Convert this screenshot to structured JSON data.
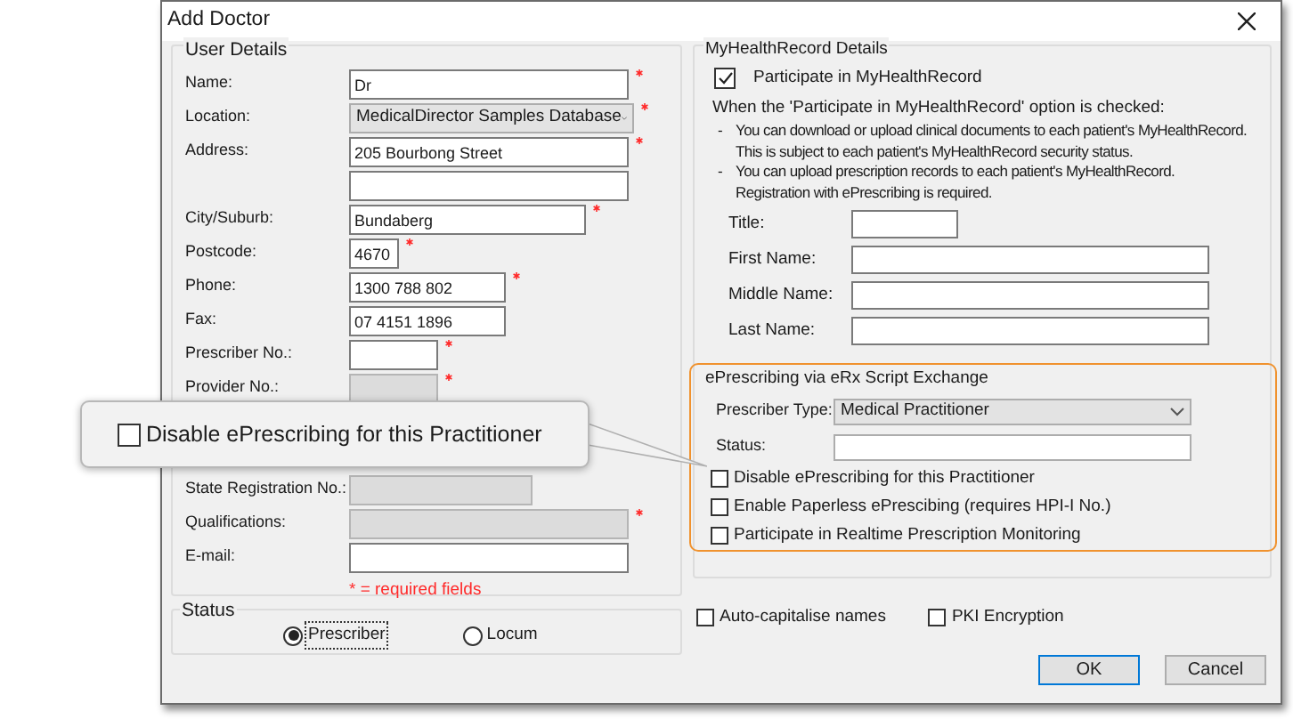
{
  "window": {
    "title": "Add Doctor"
  },
  "user_details": {
    "title": "User Details",
    "fields": [
      {
        "label": "Name:",
        "kind": "text",
        "value": "Dr",
        "required": true,
        "disabled": false
      },
      {
        "label": "Location:",
        "kind": "dropdown",
        "value": "MedicalDirector Samples Database",
        "required": true
      },
      {
        "label": "Address:",
        "kind": "text",
        "value": "205 Bourbong Street",
        "required": true,
        "disabled": false
      },
      {
        "kind": "text",
        "required": false,
        "disabled": false
      },
      {
        "label": "City/Suburb:",
        "kind": "text",
        "value": "Bundaberg",
        "required": true,
        "disabled": false
      },
      {
        "label": "Postcode:",
        "kind": "text",
        "value": "4670",
        "required": true,
        "disabled": false
      },
      {
        "label": "Phone:",
        "kind": "text",
        "value": "1300 788 802",
        "required": true,
        "disabled": false
      },
      {
        "label": "Fax:",
        "kind": "text",
        "value": "07 4151 1896",
        "required": false,
        "disabled": false
      },
      {
        "label": "Prescriber No.:",
        "kind": "text",
        "required": true,
        "disabled": false
      },
      {
        "label": "Provider No.:",
        "kind": "text",
        "required": true,
        "disabled": true
      }
    ],
    "fields_below_callout": [
      {
        "label": "State Registration No.:",
        "required": false,
        "disabled": true
      },
      {
        "label": "Qualifications:",
        "required": true,
        "disabled": true
      },
      {
        "label": "E-mail:",
        "required": false,
        "disabled": false
      }
    ],
    "required_note": "* = required fields"
  },
  "status": {
    "title": "Status",
    "options": [
      {
        "label": "Prescriber",
        "selected": true
      },
      {
        "label": "Locum",
        "selected": false
      }
    ]
  },
  "myhealthrecord": {
    "title": "MyHealthRecord Details",
    "participate": {
      "label": "Participate in MyHealthRecord",
      "checked": true
    },
    "intro": "When the 'Participate in MyHealthRecord' option is checked:",
    "bullets": [
      {
        "marker": "-",
        "lines": [
          "You can download or upload clinical documents to each patient's MyHealthRecord.",
          "This is subject to each patient's MyHealthRecord security status."
        ]
      },
      {
        "marker": "-",
        "lines": [
          "You can upload prescription records to each patient's MyHealthRecord.",
          "Registration with ePrescribing is required."
        ]
      }
    ],
    "fields": [
      {
        "label": "Title:",
        "kind": "short"
      },
      {
        "label": "First Name:",
        "kind": "long"
      },
      {
        "label": "Middle Name:",
        "kind": "long"
      },
      {
        "label": "Last Name:",
        "kind": "long"
      }
    ]
  },
  "eprescribing": {
    "title": "ePrescribing via eRx Script Exchange",
    "highlighted": true,
    "prescriber_type": {
      "label": "Prescriber Type:",
      "value": "Medical Practitioner"
    },
    "status": {
      "label": "Status:"
    },
    "options": [
      {
        "label": "Disable ePrescribing for this Practitioner",
        "checked": false
      },
      {
        "label": "Enable Paperless ePrescibing (requires HPI-I No.)",
        "checked": false
      },
      {
        "label": "Participate in Realtime Prescription Monitoring",
        "checked": false
      }
    ]
  },
  "options": [
    {
      "label": "Auto-capitalise names",
      "checked": false
    },
    {
      "label": "PKI Encryption",
      "checked": false
    }
  ],
  "buttons": [
    {
      "label": "OK",
      "default": true
    },
    {
      "label": "Cancel",
      "default": false
    }
  ],
  "callout": {
    "label": "Disable ePrescribing for this Practitioner",
    "checked": false
  }
}
